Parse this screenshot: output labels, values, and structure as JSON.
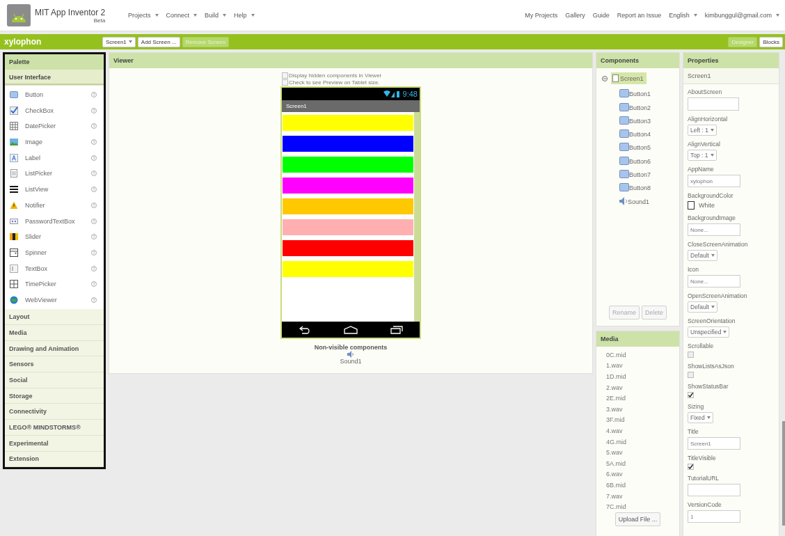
{
  "header": {
    "app_name": "MIT App Inventor 2",
    "app_sub": "Beta",
    "menus": [
      {
        "label": "Projects",
        "dropdown": true
      },
      {
        "label": "Connect",
        "dropdown": true
      },
      {
        "label": "Build",
        "dropdown": true
      },
      {
        "label": "Help",
        "dropdown": true
      }
    ],
    "links": [
      {
        "label": "My Projects",
        "dropdown": false
      },
      {
        "label": "Gallery",
        "dropdown": false
      },
      {
        "label": "Guide",
        "dropdown": false
      },
      {
        "label": "Report an Issue",
        "dropdown": false
      },
      {
        "label": "English",
        "dropdown": true
      },
      {
        "label": "kimbunggul@gmail.com",
        "dropdown": true
      }
    ]
  },
  "project_bar": {
    "title": "xylophon",
    "buttons": [
      {
        "label": "Screen1",
        "dropdown": true,
        "disabled": false
      },
      {
        "label": "Add Screen ...",
        "dropdown": false,
        "disabled": false
      },
      {
        "label": "Remove Screen",
        "dropdown": false,
        "disabled": true
      }
    ],
    "views": [
      {
        "label": "Designer",
        "selected": true
      },
      {
        "label": "Blocks",
        "selected": false
      }
    ]
  },
  "palette": {
    "title": "Palette",
    "categories": [
      {
        "label": "User Interface",
        "expanded": true,
        "items": [
          {
            "label": "Button",
            "kind": "button"
          },
          {
            "label": "CheckBox",
            "kind": "checkbox"
          },
          {
            "label": "DatePicker",
            "kind": "datepicker"
          },
          {
            "label": "Image",
            "kind": "image"
          },
          {
            "label": "Label",
            "kind": "label"
          },
          {
            "label": "ListPicker",
            "kind": "listpicker"
          },
          {
            "label": "ListView",
            "kind": "listview"
          },
          {
            "label": "Notifier",
            "kind": "notifier"
          },
          {
            "label": "PasswordTextBox",
            "kind": "password"
          },
          {
            "label": "Slider",
            "kind": "slider"
          },
          {
            "label": "Spinner",
            "kind": "spinner"
          },
          {
            "label": "TextBox",
            "kind": "textbox"
          },
          {
            "label": "TimePicker",
            "kind": "timepicker"
          },
          {
            "label": "WebViewer",
            "kind": "webviewer"
          }
        ]
      },
      {
        "label": "Layout",
        "expanded": false
      },
      {
        "label": "Media",
        "expanded": false
      },
      {
        "label": "Drawing and Animation",
        "expanded": false
      },
      {
        "label": "Sensors",
        "expanded": false
      },
      {
        "label": "Social",
        "expanded": false
      },
      {
        "label": "Storage",
        "expanded": false
      },
      {
        "label": "Connectivity",
        "expanded": false
      },
      {
        "label": "LEGO® MINDSTORMS®",
        "expanded": false
      },
      {
        "label": "Experimental",
        "expanded": false
      },
      {
        "label": "Extension",
        "expanded": false
      }
    ]
  },
  "viewer": {
    "title": "Viewer",
    "options": [
      {
        "label": "Display hidden components in Viewer",
        "checked": false
      },
      {
        "label": "Check to see Preview on Tablet size.",
        "checked": false
      }
    ],
    "phone": {
      "time": "9:48",
      "screen_title": "Screen1",
      "buttons": [
        {
          "color": "#ffff00"
        },
        {
          "color": "#0000ff"
        },
        {
          "color": "#00ff00"
        },
        {
          "color": "#ff00ff"
        },
        {
          "color": "#ffc800"
        },
        {
          "color": "#ffafaf"
        },
        {
          "color": "#ff0000"
        },
        {
          "color": "#ffff00"
        }
      ]
    },
    "nonvisible_title": "Non-visible components",
    "nonvisible": [
      {
        "label": "Sound1"
      }
    ]
  },
  "components": {
    "title": "Components",
    "tree": [
      {
        "label": "Screen1",
        "kind": "screen",
        "selected": true,
        "expanded": true,
        "children": [
          {
            "label": "Button1",
            "kind": "button",
            "selected": false
          },
          {
            "label": "Button2",
            "kind": "button",
            "selected": false
          },
          {
            "label": "Button3",
            "kind": "button",
            "selected": false
          },
          {
            "label": "Button4",
            "kind": "button",
            "selected": false
          },
          {
            "label": "Button5",
            "kind": "button",
            "selected": false
          },
          {
            "label": "Button6",
            "kind": "button",
            "selected": false
          },
          {
            "label": "Button7",
            "kind": "button",
            "selected": false
          },
          {
            "label": "Button8",
            "kind": "button",
            "selected": false
          },
          {
            "label": "Sound1",
            "kind": "sound",
            "selected": false
          }
        ]
      }
    ],
    "buttons": [
      {
        "label": "Rename",
        "disabled": true
      },
      {
        "label": "Delete",
        "disabled": true
      }
    ]
  },
  "media": {
    "title": "Media",
    "files": [
      "0C.mid",
      "1.wav",
      "1D.mid",
      "2.wav",
      "2E.mid",
      "3.wav",
      "3F.mid",
      "4.wav",
      "4G.mid",
      "5.wav",
      "5A.mid",
      "6.wav",
      "6B.mid",
      "7.wav",
      "7C.mid"
    ],
    "upload": "Upload File ..."
  },
  "properties": {
    "title": "Properties",
    "subject": "Screen1",
    "items": [
      {
        "label": "AboutScreen",
        "kind": "textarea"
      },
      {
        "label": "AlignHorizontal",
        "kind": "dropdown",
        "value": "Left : 1"
      },
      {
        "label": "AlignVertical",
        "kind": "dropdown",
        "value": "Top : 1"
      },
      {
        "label": "AppName",
        "kind": "text",
        "value": "xylophon"
      },
      {
        "label": "BackgroundColor",
        "kind": "color",
        "value": "White",
        "color": "#ffffff"
      },
      {
        "label": "BackgroundImage",
        "kind": "text",
        "value": "None..."
      },
      {
        "label": "CloseScreenAnimation",
        "kind": "dropdown",
        "value": "Default"
      },
      {
        "label": "Icon",
        "kind": "text",
        "value": "None..."
      },
      {
        "label": "OpenScreenAnimation",
        "kind": "dropdown",
        "value": "Default"
      },
      {
        "label": "ScreenOrientation",
        "kind": "dropdown",
        "value": "Unspecified"
      },
      {
        "label": "Scrollable",
        "kind": "checkbox",
        "checked": false
      },
      {
        "label": "ShowListsAsJson",
        "kind": "checkbox",
        "checked": false
      },
      {
        "label": "ShowStatusBar",
        "kind": "checkbox",
        "checked": true
      },
      {
        "label": "Sizing",
        "kind": "dropdown",
        "value": "Fixed"
      },
      {
        "label": "Title",
        "kind": "text",
        "value": "Screen1"
      },
      {
        "label": "TitleVisible",
        "kind": "checkbox",
        "checked": true
      },
      {
        "label": "TutorialURL",
        "kind": "text"
      },
      {
        "label": "VersionCode",
        "kind": "text",
        "value": "1"
      }
    ]
  }
}
